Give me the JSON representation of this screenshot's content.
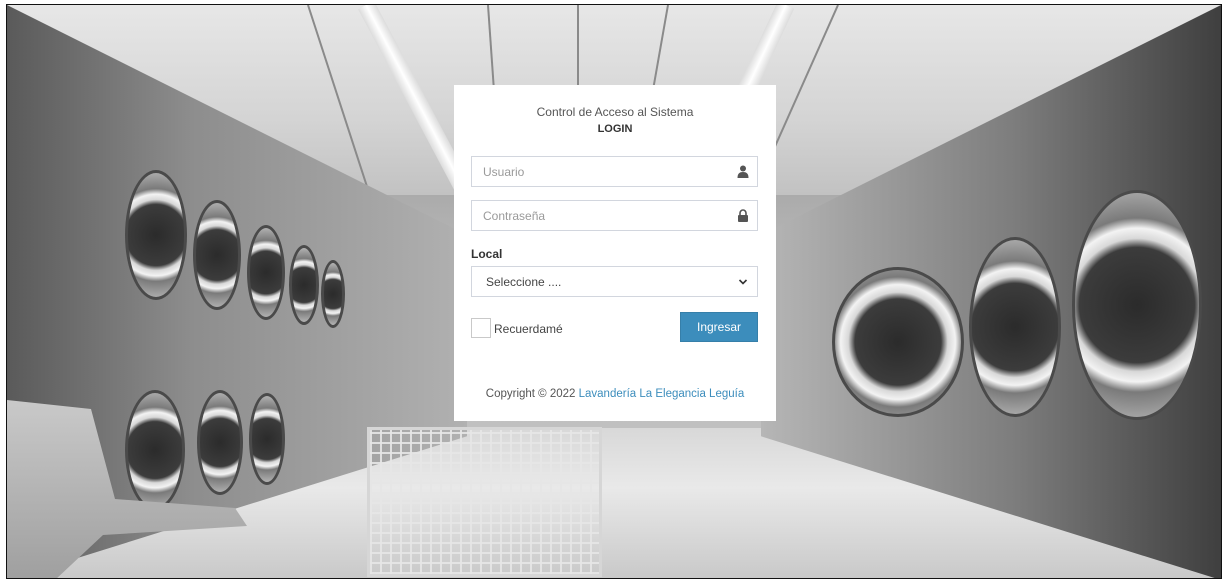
{
  "login": {
    "title": "Control de Acceso al Sistema",
    "subtitle": "LOGIN",
    "username": {
      "placeholder": "Usuario",
      "value": "",
      "icon": "user-icon"
    },
    "password": {
      "placeholder": "Contraseña",
      "value": "",
      "icon": "lock-icon"
    },
    "local": {
      "label": "Local",
      "selected": "Seleccione ....",
      "icon": "chevron-down-icon"
    },
    "remember_label": "Recuerdamé",
    "remember_checked": false,
    "submit_label": "Ingresar"
  },
  "footer": {
    "copyright": "Copyright © 2022 ",
    "company_link": "Lavandería La Elegancia Leguía"
  },
  "colors": {
    "primary": "#3c8dbc",
    "border": "#d2d6de",
    "card_bg": "#ffffff"
  }
}
